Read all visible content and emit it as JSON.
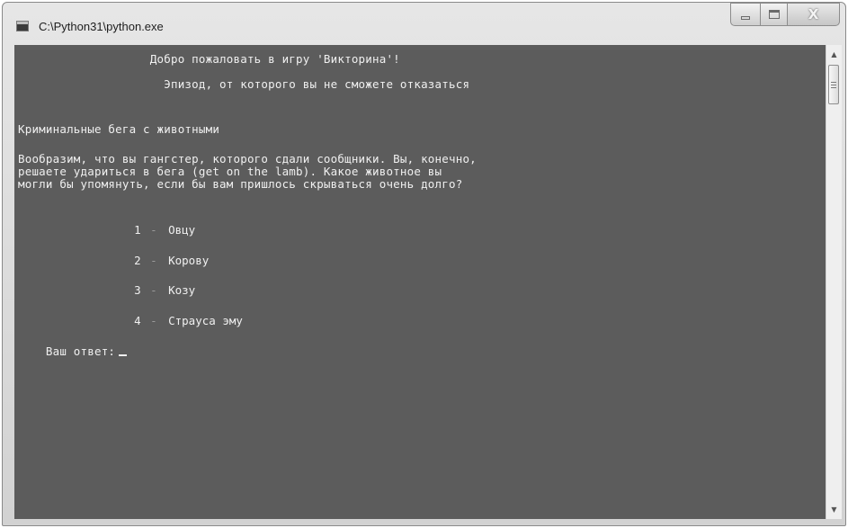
{
  "window": {
    "title": "C:\\Python31\\python.exe",
    "close_glyph": "X"
  },
  "console": {
    "lines": [
      "                   Добро пожаловать в игру 'Викторина'!",
      "                     Эпизод, от которого вы не сможете отказаться",
      "Криминальные бега с животными",
      "Вообразим, что вы гангстер, которого сдали сообщники. Вы, конечно,",
      "решаете удариться в бега (get on the lamb). Какое животное вы",
      "могли бы упомянуть, если бы вам пришлось скрываться очень долго?"
    ],
    "options": [
      {
        "num": "1",
        "dash": "-",
        "text": "Овцу"
      },
      {
        "num": "2",
        "dash": "-",
        "text": "Корову"
      },
      {
        "num": "3",
        "dash": "-",
        "text": "Козу"
      },
      {
        "num": "4",
        "dash": "-",
        "text": "Страуса эму"
      }
    ],
    "prompt": "Ваш ответ:"
  },
  "icons": {
    "app": "console-icon",
    "minimize": "minimize-icon",
    "maximize": "maximize-icon",
    "close": "close-icon",
    "scroll_up": "scroll-up-arrow-icon",
    "scroll_down": "scroll-down-arrow-icon"
  },
  "colors": {
    "console_bg": "#5c5c5c",
    "console_text": "#f0f0f0",
    "chrome": "#d8d8d8"
  }
}
